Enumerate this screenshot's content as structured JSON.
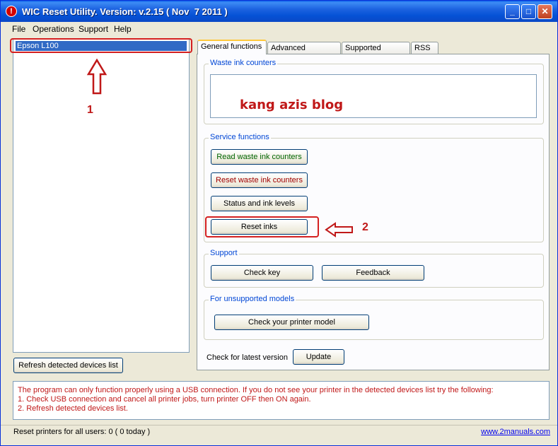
{
  "window": {
    "title": "WIC Reset Utility. Version: v.2.15 ( Nov  7 2011 )",
    "icon_glyph": "!",
    "minimize_glyph": "_",
    "maximize_glyph": "□",
    "close_glyph": "✕"
  },
  "menu": [
    "File",
    "Operations",
    "Support",
    "Help"
  ],
  "devices": {
    "items": [
      "Epson L100"
    ],
    "refresh_label": "Refresh detected devices list"
  },
  "tabs": [
    {
      "label": "General functions",
      "active": true
    },
    {
      "label": "Advanced functions"
    },
    {
      "label": "Supported models"
    },
    {
      "label": "RSS"
    }
  ],
  "general": {
    "waste_group": "Waste ink counters",
    "waste_value": "",
    "service_group": "Service functions",
    "read_waste": "Read waste ink counters",
    "reset_waste": "Reset waste ink counters",
    "status_ink": "Status and ink levels",
    "reset_inks": "Reset inks",
    "support_group": "Support",
    "check_key": "Check key",
    "feedback": "Feedback",
    "unsupported_group": "For unsupported models",
    "check_printer": "Check your printer model",
    "latest_version_label": "Check for latest version",
    "update": "Update"
  },
  "annotations": {
    "marker_1": "1",
    "marker_2": "2",
    "watermark": "kang azis blog"
  },
  "message": {
    "line1": "The program can only function properly using a USB connection. If you do not see your printer in the detected devices list try the following:",
    "line2": "1. Check USB connection and cancel all printer jobs, turn printer OFF then ON again.",
    "line3": "2. Refresh detected devices list."
  },
  "status": {
    "left": "Reset printers for all users: 0 ( 0 today )",
    "link": "www.2manuals.com"
  },
  "colors": {
    "title_blue": "#0552d6",
    "annotation_red": "#c01818",
    "read_green": "#006400",
    "reset_red": "#a00000",
    "selection": "#316ac5"
  }
}
